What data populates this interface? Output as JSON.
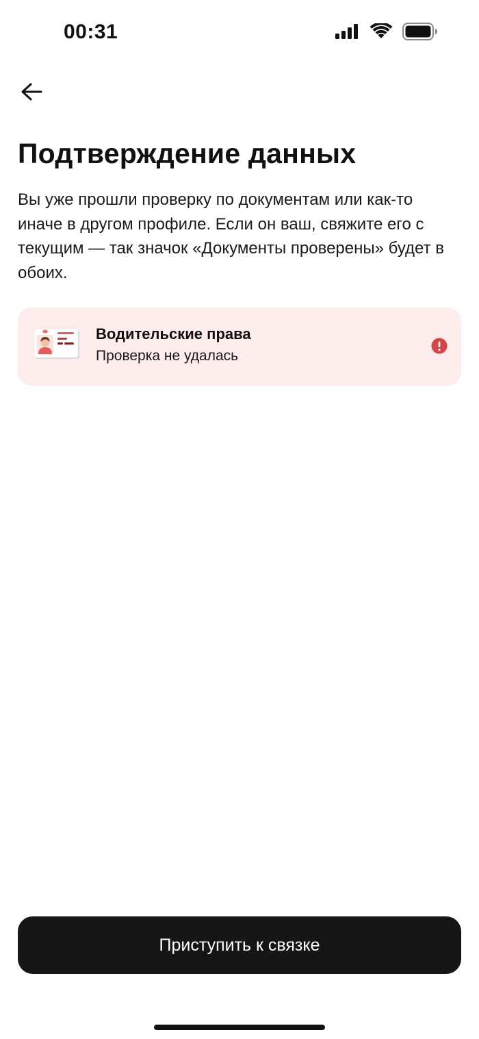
{
  "status_bar": {
    "time": "00:31",
    "icons": [
      "cellular-signal-icon",
      "wifi-icon",
      "battery-icon"
    ]
  },
  "header": {
    "back_icon": "arrow-left-icon"
  },
  "main": {
    "title": "Подтверждение данных",
    "description": "Вы уже прошли проверку по документам или как-то иначе в другом профиле. Если он ваш, свяжите его с текущим — так значок «Документы проверены» будет в обоих."
  },
  "document_card": {
    "title": "Водительские права",
    "status": "Проверка не удалась",
    "icon": "driver-license-icon",
    "status_icon": "error-alert-icon",
    "colors": {
      "background": "#fdecec",
      "alert": "#d64545"
    }
  },
  "footer": {
    "primary_button_label": "Приступить к связке"
  }
}
